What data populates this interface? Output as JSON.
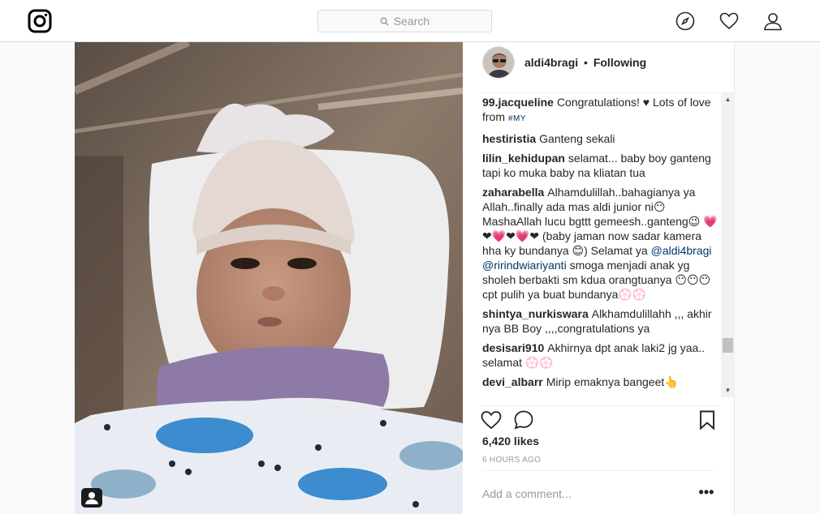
{
  "search": {
    "placeholder": "Search"
  },
  "post": {
    "username": "aldi4bragi",
    "separator": "•",
    "follow_status": "Following",
    "likes": "6,420 likes",
    "time": "6 HOURS AGO",
    "add_comment_placeholder": "Add a comment...",
    "more_label": "•••"
  },
  "comments": [
    {
      "user": "99.jacqueline",
      "text": "Congratulations! ♥ Lots of love from",
      "tag": "#MY"
    },
    {
      "user": "hestiristia",
      "text": "Ganteng sekali"
    },
    {
      "user": "lilin_kehidupan",
      "text": "selamat... baby boy ganteng tapi ko muka baby na kliatan tua"
    },
    {
      "user": "zaharabella",
      "text": "Alhamdulillah..bahagianya ya Allah..finally ada mas aldi junior ni😶 MashaAllah lucu bgttt gemeesh..ganteng😉 💗❤💗❤💗❤ (baby jaman now sadar kamera hha ky bundanya 😊) Selamat ya",
      "mention1": "@aldi4bragi",
      "mention2": "@ririndwiariyanti",
      "text2": "smoga menjadi anak yg sholeh berbakti sm kdua orangtuanya 😶😶😶 cpt pulih ya buat bundanya💮💮"
    },
    {
      "user": "shintya_nurkiswara",
      "text": "Alkhamdulillahh ,,, akhir nya BB Boy ,,,,congratulations ya"
    },
    {
      "user": "desisari910",
      "text": "Akhirnya dpt anak laki2 jg yaa.. selamat 💮💮"
    },
    {
      "user": "devi_albarr",
      "text": "Mirip emaknya bangeet👆"
    }
  ],
  "icons": {
    "logo": "instagram-icon",
    "explore": "compass-icon",
    "activity": "heart-icon",
    "profile": "user-icon",
    "like": "heart-outline-icon",
    "comment": "comment-icon",
    "save": "bookmark-icon",
    "tag": "tagged-user-icon"
  },
  "colors": {
    "link": "#003569",
    "text": "#262626",
    "muted": "#999999",
    "border": "#dbdbdb"
  }
}
